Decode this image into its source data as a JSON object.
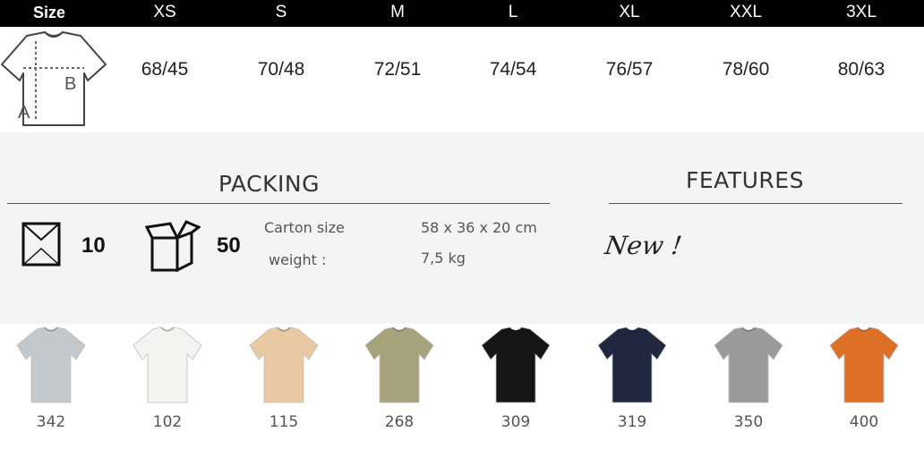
{
  "size_table": {
    "header": [
      "Size",
      "XS",
      "S",
      "M",
      "L",
      "XL",
      "XXL",
      "3XL"
    ],
    "diagram_labels": {
      "a": "A",
      "b": "B"
    },
    "values": [
      "68/45",
      "70/48",
      "72/51",
      "74/54",
      "76/57",
      "78/60",
      "80/63"
    ]
  },
  "packing": {
    "title": "PACKING",
    "bag_count": "10",
    "carton_count": "50",
    "carton_size_label": "Carton size",
    "carton_size_value": "58 x 36 x 20 cm",
    "weight_label": "weight :",
    "weight_value": "7,5 kg"
  },
  "features": {
    "title": "FEATURES",
    "new_label": "New !"
  },
  "colors": [
    {
      "code": "342",
      "color": "#c3c8cc"
    },
    {
      "code": "102",
      "color": "#f3f3f1"
    },
    {
      "code": "115",
      "color": "#e8c9a2"
    },
    {
      "code": "268",
      "color": "#a6a27c"
    },
    {
      "code": "309",
      "color": "#151515"
    },
    {
      "code": "319",
      "color": "#20273e"
    },
    {
      "code": "350",
      "color": "#9a9a9a"
    },
    {
      "code": "400",
      "color": "#dd6f27"
    }
  ]
}
